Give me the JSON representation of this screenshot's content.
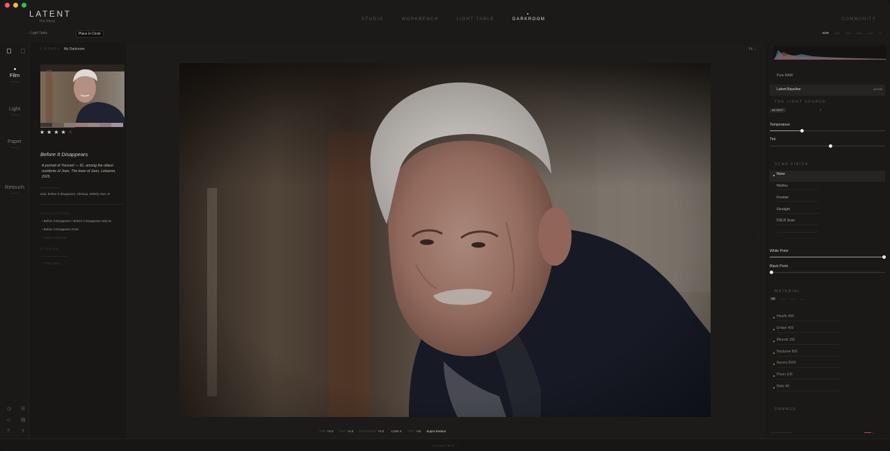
{
  "window": {
    "traffic_lights": [
      "#fd5f57",
      "#febc2e",
      "#28c840"
    ]
  },
  "brand": {
    "title": "LATENT",
    "subtitle": "The Ritual"
  },
  "nav": [
    {
      "label": "STUDIO",
      "active": false
    },
    {
      "label": "WORKBENCH",
      "active": false
    },
    {
      "label": "LIGHT TABLE",
      "active": false
    },
    {
      "label": "DARKROOM",
      "active": true
    }
  ],
  "community": "COMMUNITY",
  "toolbar": {
    "back_label": "‹ Light Table",
    "circle_button": "Place in Circle",
    "right_items": [
      "SDR",
      "",
      "",
      "",
      "",
      ""
    ]
  },
  "rail": {
    "items": [
      {
        "label": "Film",
        "sub": "Develop",
        "active": true
      },
      {
        "label": "Light",
        "sub": "",
        "active": false
      },
      {
        "label": "Paper",
        "sub": "",
        "active": false
      },
      {
        "label": "Retouch",
        "sub": "",
        "active": false
      }
    ]
  },
  "library": {
    "label": "LIBRARY",
    "breadcrumb_value": "My Darkroom",
    "rating": 4,
    "rating_max": 5,
    "photo_title": "Before It Disappears",
    "photo_description": "A portrait of Youssef — 91, among the oldest residents of Joun. The town of Joun, Lebanon, 2025.",
    "tags": "asia, before it disappears, closeup, elderly man, le",
    "collections_label": "COLLECTIONS",
    "collections": [
      "Before It Disappears / Before It Disappears Selects",
      "Before It Disappears RAW"
    ],
    "add_collection": "Add to collection",
    "stories_label": "STORIES",
    "add_story": "Add to story",
    "swatch_colors": [
      "#6b5a50",
      "#8d7b72",
      "#a27a76",
      "#a38680",
      "#8f7c80",
      "#a4959a",
      "#b7aeb0"
    ]
  },
  "stage": {
    "fit_label": "Fit ⌄",
    "status": [
      {
        "k": "TMP",
        "v": "+0.0"
      },
      {
        "k": "TINT",
        "v": "+0.5"
      },
      {
        "k": "EXPOSURE",
        "v": "+0.0"
      },
      {
        "k": "",
        "v": "4,856 K"
      },
      {
        "k": "TINT",
        "v": "+16"
      }
    ],
    "film_name": "Supra Endura"
  },
  "bottom_bar": {
    "label": "FILMSTRIP ⌃"
  },
  "panel": {
    "recipes": [
      {
        "label": "Pure RAW",
        "active": false
      },
      {
        "label": "Latent Baseline",
        "active": true,
        "badge": "ACTIVE"
      }
    ],
    "light_source": {
      "heading": "THE LIGHT SOURCE",
      "mode": "AS SHOT",
      "temperature_label": "Temperature",
      "temperature_level": 0.28,
      "tint_label": "Tint",
      "tint_level": 0.53
    },
    "scan_finish": {
      "heading": "SCAN FINISH",
      "options": [
        "None",
        "Noritsu",
        "Frontier",
        "Flextight",
        "DSLR Scan"
      ],
      "selected": "None"
    },
    "white_point_label": "White Point",
    "white_point_level": 1.0,
    "black_point_label": "Black Point",
    "black_point_level": 0.0,
    "material": {
      "heading": "MATERIAL",
      "filter": "All",
      "films": [
        "Hearth 400",
        "Ember 400",
        "Mineral 100",
        "Nocturne 800",
        "Aurora 2500",
        "Prism 100",
        "Relic 40"
      ]
    },
    "damage_heading": "DAMAGE",
    "accent": "#c9934f"
  }
}
